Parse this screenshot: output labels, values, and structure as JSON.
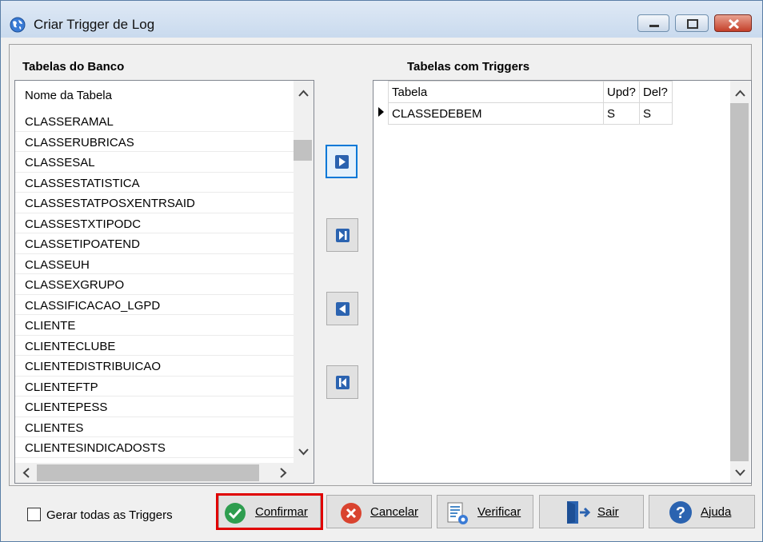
{
  "window": {
    "title": "Criar Trigger de Log"
  },
  "left_panel": {
    "label": "Tabelas do Banco",
    "column_header": "Nome da Tabela",
    "items": [
      "CLASSERAMAL",
      "CLASSERUBRICAS",
      "CLASSESAL",
      "CLASSESTATISTICA",
      "CLASSESTATPOSXENTRSAID",
      "CLASSESTXTIPODC",
      "CLASSETIPOATEND",
      "CLASSEUH",
      "CLASSEXGRUPO",
      "CLASSIFICACAO_LGPD",
      "CLIENTE",
      "CLIENTECLUBE",
      "CLIENTEDISTRIBUICAO",
      "CLIENTEFTP",
      "CLIENTEPESS",
      "CLIENTES",
      "CLIENTESINDICADOSTS"
    ]
  },
  "right_panel": {
    "label": "Tabelas com Triggers",
    "columns": [
      "Tabela",
      "Upd?",
      "Del?"
    ],
    "rows": [
      {
        "tabela": "CLASSEDEBEM",
        "upd": "S",
        "del": "S"
      }
    ]
  },
  "footer": {
    "checkbox_label": "Gerar todas as Triggers",
    "confirm_label": "Confirmar",
    "cancel_label": "Cancelar",
    "verify_label": "Verificar",
    "exit_label": "Sair",
    "help_label": "Ajuda"
  },
  "colors": {
    "accent_blue": "#0078d7",
    "highlight_red": "#e00000",
    "confirm_green": "#2e9d4f",
    "cancel_red": "#d9432f"
  }
}
